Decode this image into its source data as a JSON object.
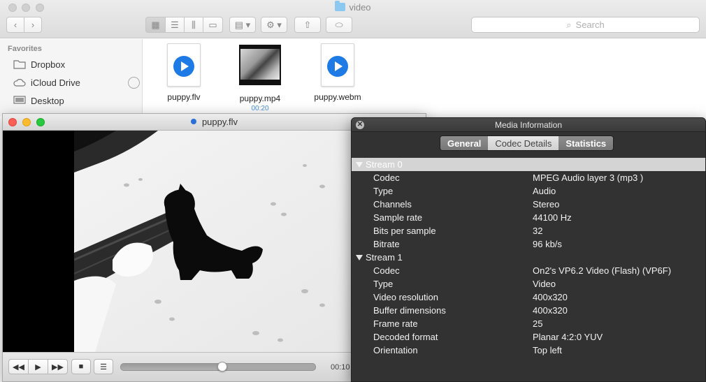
{
  "finder": {
    "title": "video",
    "search_placeholder": "Search",
    "sidebar": {
      "heading": "Favorites",
      "items": [
        {
          "label": "Dropbox",
          "icon": "folder-icon"
        },
        {
          "label": "iCloud Drive",
          "icon": "cloud-icon"
        },
        {
          "label": "Desktop",
          "icon": "desktop-icon"
        }
      ]
    },
    "files": [
      {
        "name": "puppy.flv",
        "sub": ""
      },
      {
        "name": "puppy.mp4",
        "sub": "00:20"
      },
      {
        "name": "puppy.webm",
        "sub": ""
      }
    ]
  },
  "player": {
    "title": "puppy.flv",
    "time": "00:10",
    "progress": 0.52
  },
  "media_info": {
    "title": "Media Information",
    "tabs": [
      "General",
      "Codec Details",
      "Statistics"
    ],
    "selected_tab": "Codec Details",
    "streams": [
      {
        "name": "Stream 0",
        "properties": [
          {
            "key": "Codec",
            "value": "MPEG Audio layer 3 (mp3 )"
          },
          {
            "key": "Type",
            "value": "Audio"
          },
          {
            "key": "Channels",
            "value": "Stereo"
          },
          {
            "key": "Sample rate",
            "value": "44100 Hz"
          },
          {
            "key": "Bits per sample",
            "value": "32"
          },
          {
            "key": "Bitrate",
            "value": "96 kb/s"
          }
        ]
      },
      {
        "name": "Stream 1",
        "properties": [
          {
            "key": "Codec",
            "value": "On2's VP6.2 Video (Flash) (VP6F)"
          },
          {
            "key": "Type",
            "value": "Video"
          },
          {
            "key": "Video resolution",
            "value": "400x320"
          },
          {
            "key": "Buffer dimensions",
            "value": "400x320"
          },
          {
            "key": "Frame rate",
            "value": "25"
          },
          {
            "key": "Decoded format",
            "value": "Planar 4:2:0 YUV"
          },
          {
            "key": "Orientation",
            "value": "Top left"
          }
        ]
      }
    ]
  },
  "colors": {
    "panel_bg": "#323232",
    "accent_blue": "#1e7be6",
    "traffic_red": "#fc5f57",
    "traffic_yellow": "#fdbc2e",
    "traffic_green": "#28c840"
  }
}
